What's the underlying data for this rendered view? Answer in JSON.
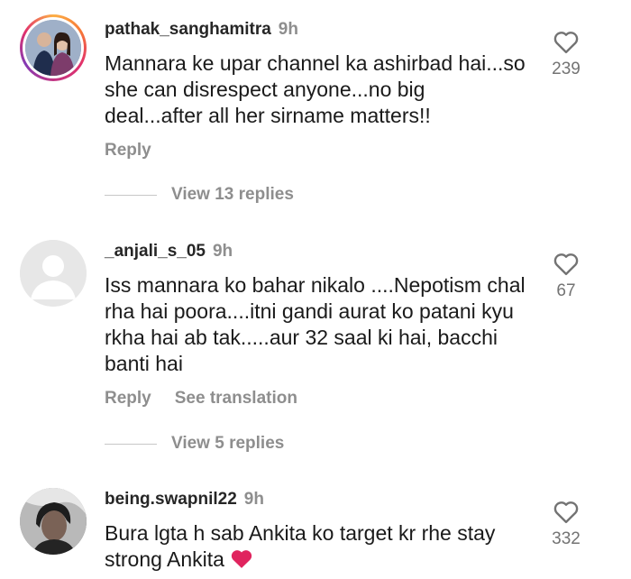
{
  "comments": [
    {
      "username": "pathak_sanghamitra",
      "time": "9h",
      "text": "Mannara ke upar channel ka ashirbad hai...so she can disrespect anyone...no big deal...after all her sirname matters!!",
      "likes": "239",
      "reply_label": "Reply",
      "view_replies": "View 13 replies",
      "avatar": "story-ring-couple-photo"
    },
    {
      "username": "_anjali_s_05",
      "time": "9h",
      "text": "Iss mannara ko bahar nikalo ....Nepotism chal rha hai poora....itni gandi aurat ko patani kyu rkha hai ab tak.....aur 32 saal ki hai, bacchi banti hai",
      "likes": "67",
      "reply_label": "Reply",
      "translation_label": "See translation",
      "view_replies": "View 5 replies",
      "avatar": "default-avatar"
    },
    {
      "username": "being.swapnil22",
      "time": "9h",
      "text": "Bura lgta h sab Ankita ko target kr rhe stay strong Ankita",
      "emoji": "red-heart",
      "likes": "332",
      "avatar": "man-photo"
    }
  ],
  "colors": {
    "text": "#1a1a1a",
    "muted": "#8e8e8e",
    "heart_red": "#e0245e"
  }
}
